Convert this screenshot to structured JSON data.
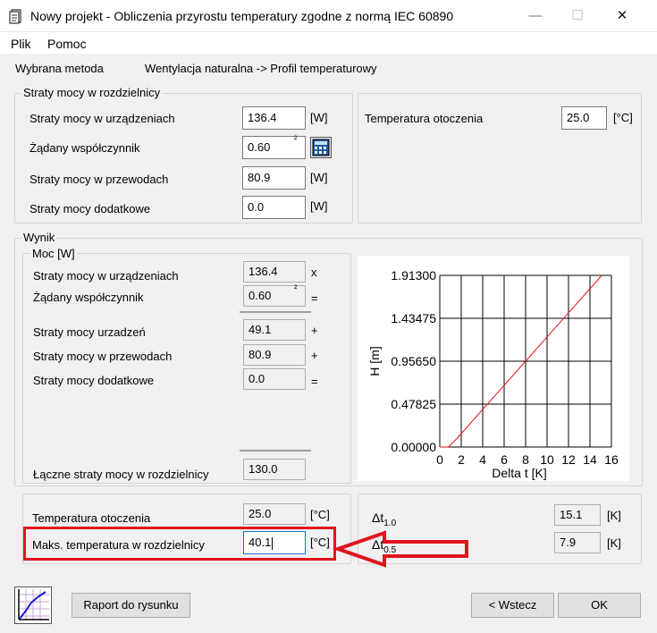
{
  "window": {
    "title": "Nowy projekt - Obliczenia przyrostu temperatury zgodne z normą IEC 60890",
    "minimize": "—",
    "maximize": "☐",
    "close": "✕",
    "app_icon": "document-icon"
  },
  "menu": {
    "file": "Plik",
    "help": "Pomoc"
  },
  "method": {
    "label": "Wybrana metoda",
    "value": "Wentylacja naturalna -> Profil temperaturowy"
  },
  "losses": {
    "caption": "Straty mocy w rozdzielnicy",
    "device_label": "Straty mocy w urządzeniach",
    "device_value": "136.4",
    "device_unit": "[W]",
    "factor_label": "Żądany współczynnik",
    "factor_value": "0.60",
    "factor_sup": "²",
    "wires_label": "Straty mocy w przewodach",
    "wires_value": "80.9",
    "wires_unit": "[W]",
    "extra_label": "Straty mocy dodatkowe",
    "extra_value": "0.0",
    "extra_unit": "[W]",
    "calc_icon": "calculator-icon"
  },
  "ambient": {
    "label": "Temperatura otoczenia",
    "value": "25.0",
    "unit": "[°C]"
  },
  "result": {
    "caption": "Wynik",
    "power_caption": "Moc [W]",
    "device_label": "Straty mocy w urządzeniach",
    "device_value": "136.4",
    "device_op": "x",
    "factor_label": "Żądany współczynnik",
    "factor_value": "0.60",
    "factor_sup": "²",
    "factor_op": "=",
    "dev_loss_label": "Straty mocy urzadzeń",
    "dev_loss_value": "49.1",
    "dev_loss_op": "+",
    "wires_label": "Straty mocy w przewodach",
    "wires_value": "80.9",
    "wires_op": "+",
    "extra_label": "Straty mocy dodatkowe",
    "extra_value": "0.0",
    "extra_op": "=",
    "total_label": "Łączne straty mocy w rozdzielnicy",
    "total_value": "130.0"
  },
  "temps": {
    "ambient_label": "Temperatura otoczenia",
    "ambient_value": "25.0",
    "ambient_unit": "[°C]",
    "max_label": "Maks. temperatura w rozdzielnicy",
    "max_value": "40.1",
    "max_unit": "[°C]"
  },
  "deltas": {
    "d1_main": "Δt",
    "d1_sub": "1.0",
    "d1_value": "15.1",
    "d1_unit": "[K]",
    "d05_main": "Δt",
    "d05_sub": "0.5",
    "d05_value": "7.9",
    "d05_unit": "[K]"
  },
  "buttons": {
    "report": "Raport do rysunku",
    "back": "< Wstecz",
    "ok": "OK",
    "chart_icon": "chart-icon"
  },
  "chart_data": {
    "type": "line",
    "xlabel": "Delta t [K]",
    "ylabel": "H [m]",
    "xlim": [
      0,
      16
    ],
    "ylim": [
      0,
      1.913
    ],
    "x_ticks": [
      "0",
      "2",
      "4",
      "6",
      "8",
      "10",
      "12",
      "14",
      "16"
    ],
    "y_ticks": [
      "0.00000",
      "0.47825",
      "0.95650",
      "1.43475",
      "1.91300"
    ],
    "grid": true,
    "series": [
      {
        "color": "#e0141e",
        "x": [
          0,
          0.8,
          1.6,
          15.1
        ],
        "y": [
          0,
          0,
          0.096,
          1.913
        ]
      }
    ]
  },
  "colors": {
    "highlight": "#e0141e",
    "line": "#e0141e"
  }
}
